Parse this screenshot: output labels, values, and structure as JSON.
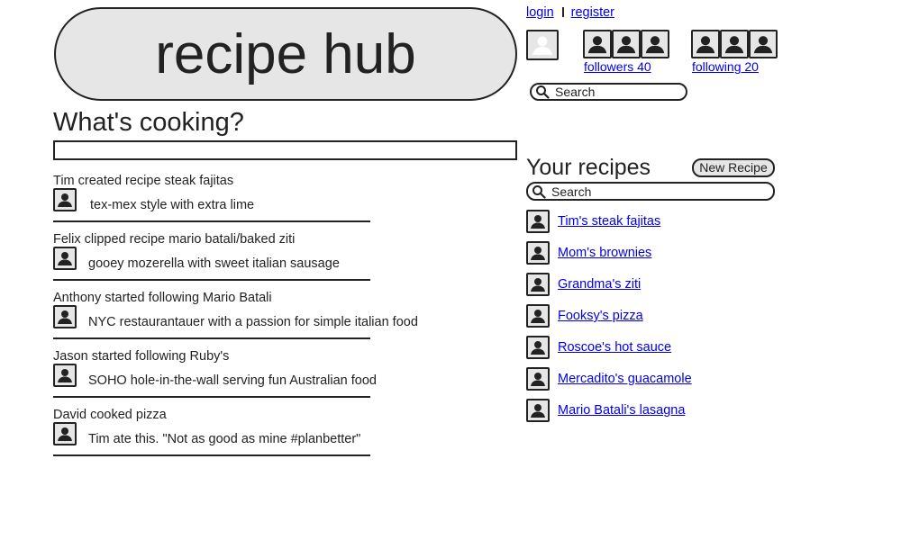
{
  "logo": {
    "text": "recipe hub"
  },
  "feed": {
    "title": "What's cooking?",
    "items": [
      {
        "headline": "Tim created recipe steak fajitas",
        "detail": "tex-mex style with extra lime"
      },
      {
        "headline": "Felix clipped recipe mario batali/baked ziti",
        "detail": "gooey mozerella with sweet italian sausage"
      },
      {
        "headline": "Anthony started following Mario Batali",
        "detail": "NYC restaurantauer with a passion for simple italian food"
      },
      {
        "headline": "Jason started following Ruby's",
        "detail": "SOHO hole-in-the-wall serving fun Australian food"
      },
      {
        "headline": "David cooked pizza",
        "detail": "Tim ate this. \"Not as good as mine #planbetter\""
      }
    ]
  },
  "auth": {
    "login": "login",
    "register": "register"
  },
  "social": {
    "followers_label": "followers 40",
    "following_label": "following 20"
  },
  "search": {
    "placeholder": "Search"
  },
  "recipes": {
    "title": "Your recipes",
    "new_button": "New Recipe",
    "search_placeholder": "Search",
    "items": [
      {
        "label": "Tim's steak fajitas"
      },
      {
        "label": "Mom's brownies"
      },
      {
        "label": "Grandma's ziti"
      },
      {
        "label": "Fooksy's pizza"
      },
      {
        "label": "Roscoe's hot sauce"
      },
      {
        "label": "Mercadito's guacamole"
      },
      {
        "label": "Mario Batali's lasagna"
      }
    ]
  },
  "icons": {
    "avatar": "person-silhouette-icon",
    "search": "magnifier-icon"
  },
  "colors": {
    "link": "#0000ee",
    "panel_fill": "#e6e6e6",
    "ink": "#222222"
  }
}
